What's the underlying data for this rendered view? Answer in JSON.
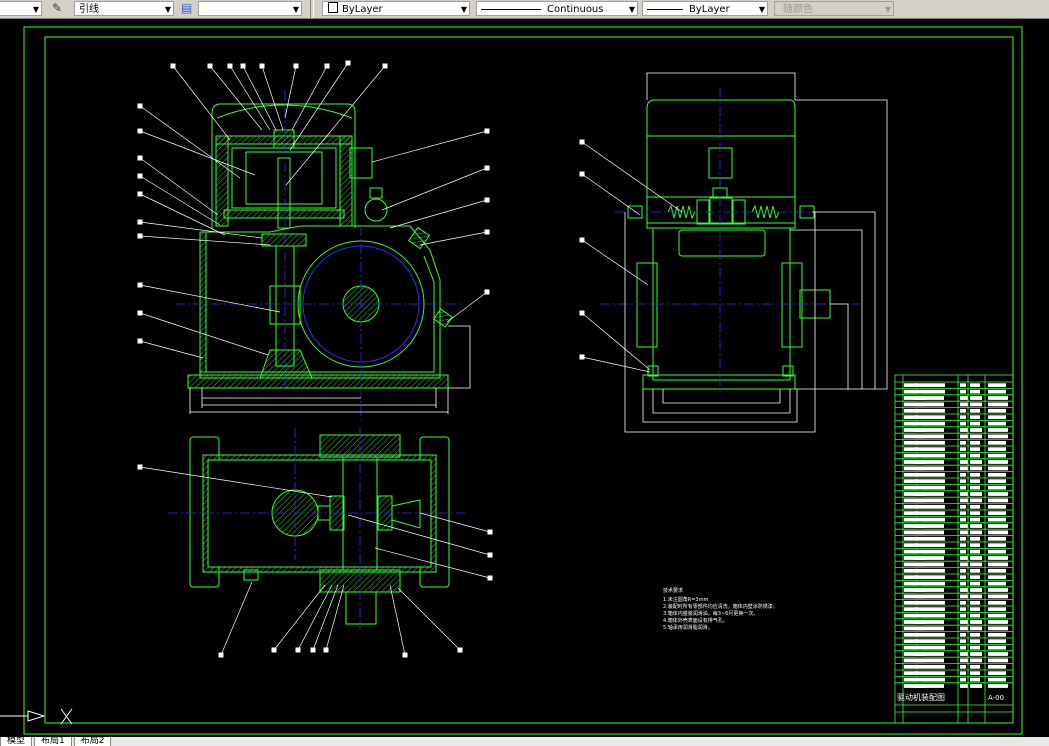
{
  "toolbar": {
    "dimstyle_label": "",
    "multileader_label": "引线",
    "table_style_label": "",
    "layer_label": "ByLayer",
    "linetype_label": "Continuous",
    "lineweight_label": "ByLayer",
    "plotstyle_label": "随颜色"
  },
  "drawing": {
    "notes_title": "技术要求",
    "notes": [
      "1.未注圆角R=3mm",
      "2.装配时所有零部件均应清洗，箱体内壁涂防锈漆。",
      "3.箱体内盛装润滑油，每3~6月更换一次。",
      "4.箱体外壳表面设有排气孔。",
      "5.轴承用润滑脂润滑。"
    ],
    "title_block": {
      "drawing_name": "驱动机装配图",
      "drawing_number": "A-00"
    },
    "colors": {
      "outline": "#33ff33",
      "centerline": "#0000cc",
      "dimension": "#ffffff",
      "background": "#000000"
    }
  },
  "layout_tabs": [
    "模型",
    "布局1",
    "布局2"
  ]
}
